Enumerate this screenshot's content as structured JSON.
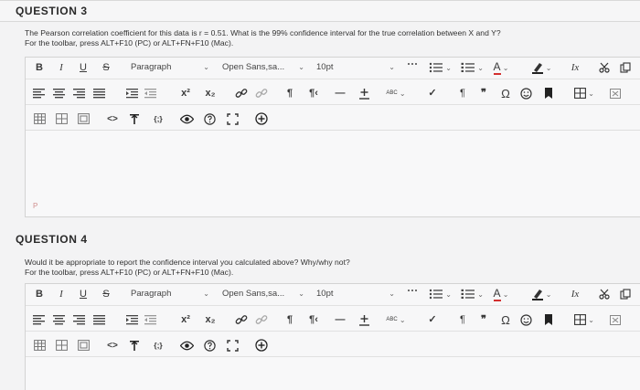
{
  "q3": {
    "title": "QUESTION 3",
    "prompt_line1": "The Pearson correlation coefficient for this data is r = 0.51. What is the 99% confidence interval for the true correlation between X and Y?",
    "prompt_line2": "For the toolbar, press ALT+F10 (PC) or ALT+FN+F10 (Mac).",
    "status": "P"
  },
  "q4": {
    "title": "QUESTION 4",
    "prompt_line1": "Would it be appropriate to report the confidence interval you calculated above? Why/why not?",
    "prompt_line2": "For the toolbar, press ALT+F10 (PC) or ALT+FN+F10 (Mac)."
  },
  "toolbar": {
    "bold": "B",
    "italic": "I",
    "underline": "U",
    "strike": "S",
    "paragraph": "Paragraph",
    "font": "Open Sans,sa...",
    "size": "10pt",
    "clear_format": "Ix",
    "superscript": "x²",
    "subscript": "x₂",
    "ltr": "¶",
    "rtl": "¶‹",
    "spellcheck": "ABC",
    "paragraph_mark": "¶",
    "quote": "❞",
    "omega": "Ω",
    "code": "<>",
    "braces": "{;}"
  },
  "colors": {
    "accent_red": "#d32f2f",
    "text": "#3a3a3a"
  }
}
